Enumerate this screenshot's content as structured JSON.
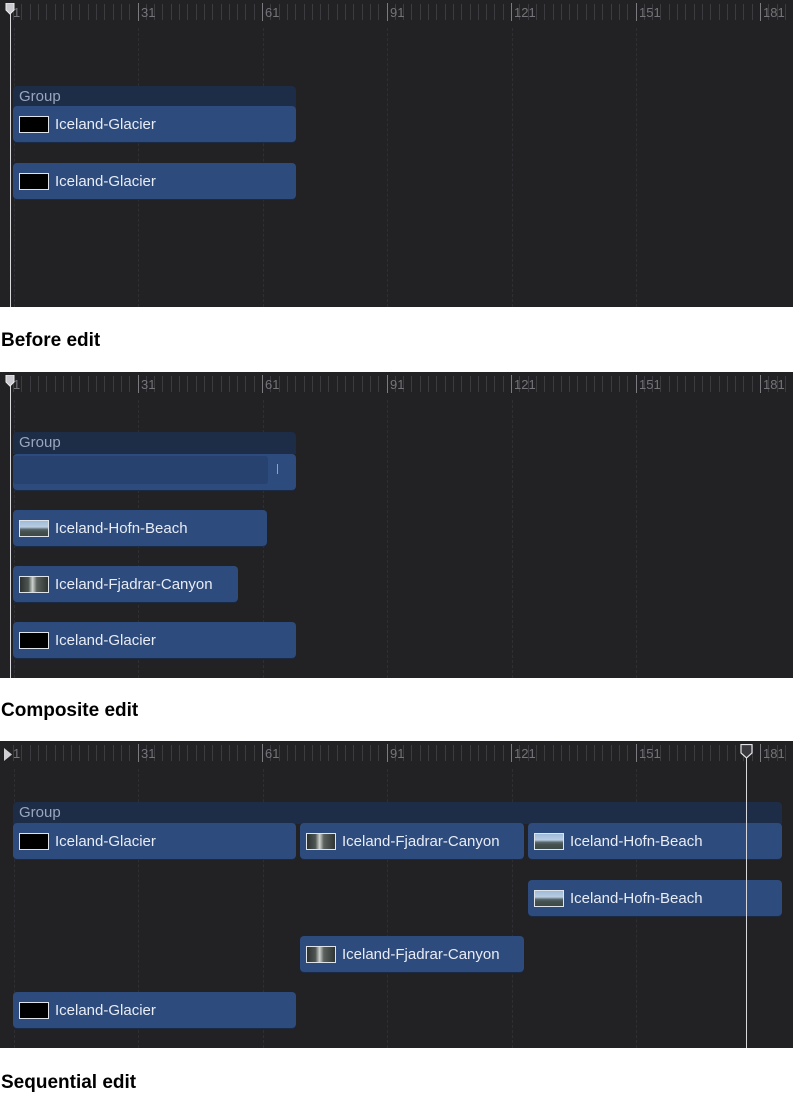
{
  "ruler_labels": [
    "1",
    "31",
    "61",
    "91",
    "121",
    "151",
    "181"
  ],
  "colors": {
    "panel_bg": "#222224",
    "clip_fill": "#2d4b7c",
    "group_fill": "#1d2c47",
    "playhead": "#d8d8dc"
  },
  "panels": [
    {
      "caption": "Before edit",
      "group_label": "Group",
      "clips": [
        {
          "label": "Iceland-Glacier",
          "thumb": "black-thumbnail"
        },
        {
          "label": "Iceland-Glacier",
          "thumb": "black-thumbnail"
        }
      ]
    },
    {
      "caption": "Composite edit",
      "group_label": "Group",
      "clips": [
        {
          "label": "Iceland-Hofn-Beach",
          "thumb": "beach-thumbnail"
        },
        {
          "label": "Iceland-Fjadrar-Canyon",
          "thumb": "canyon-thumbnail"
        },
        {
          "label": "Iceland-Glacier",
          "thumb": "black-thumbnail"
        }
      ]
    },
    {
      "caption": "Sequential edit",
      "group_label": "Group",
      "group_clips": [
        {
          "label": "Iceland-Glacier",
          "thumb": "black-thumbnail"
        },
        {
          "label": "Iceland-Fjadrar-Canyon",
          "thumb": "canyon-thumbnail"
        },
        {
          "label": "Iceland-Hofn-Beach",
          "thumb": "beach-thumbnail"
        }
      ],
      "clips": [
        {
          "label": "Iceland-Hofn-Beach",
          "thumb": "beach-thumbnail"
        },
        {
          "label": "Iceland-Fjadrar-Canyon",
          "thumb": "canyon-thumbnail"
        },
        {
          "label": "Iceland-Glacier",
          "thumb": "black-thumbnail"
        }
      ]
    }
  ]
}
